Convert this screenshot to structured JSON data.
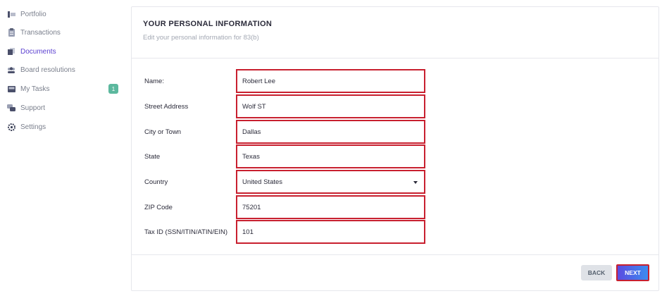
{
  "sidebar": {
    "items": [
      {
        "label": "Portfolio",
        "icon": "portfolio-icon"
      },
      {
        "label": "Transactions",
        "icon": "clipboard-icon"
      },
      {
        "label": "Documents",
        "icon": "document-icon",
        "active": true
      },
      {
        "label": "Board resolutions",
        "icon": "people-icon"
      },
      {
        "label": "My Tasks",
        "icon": "inbox-icon",
        "badge": "1"
      },
      {
        "label": "Support",
        "icon": "chat-icon"
      },
      {
        "label": "Settings",
        "icon": "gear-icon"
      }
    ]
  },
  "card": {
    "title": "YOUR PERSONAL INFORMATION",
    "subtitle": "Edit your personal information for 83(b)"
  },
  "form": {
    "name": {
      "label": "Name:",
      "value": "Robert Lee"
    },
    "street": {
      "label": "Street Address",
      "value": "Wolf ST"
    },
    "city": {
      "label": "City or Town",
      "value": "Dallas"
    },
    "state": {
      "label": "State",
      "value": "Texas"
    },
    "country": {
      "label": "Country",
      "value": "United States"
    },
    "zip": {
      "label": "ZIP Code",
      "value": "75201"
    },
    "taxid": {
      "label": "Tax ID (SSN/ITIN/ATIN/EIN)",
      "value": "101"
    }
  },
  "buttons": {
    "back": "BACK",
    "next": "NEXT"
  },
  "colors": {
    "accent": "#5a3fd0",
    "badge": "#5cb89e",
    "highlight": "#c8202f"
  }
}
